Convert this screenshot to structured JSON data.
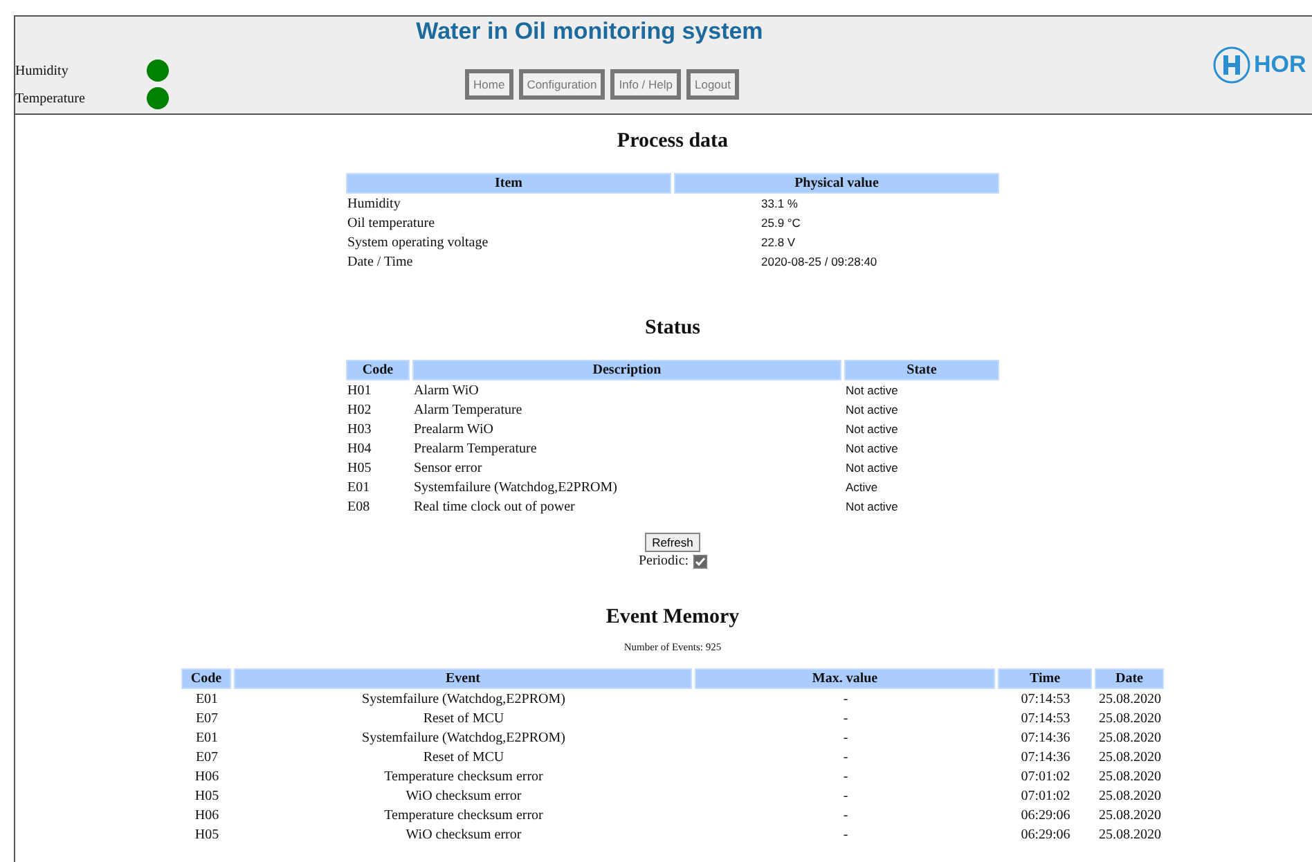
{
  "header": {
    "title": "Water in Oil monitoring system",
    "logo_text": "HOR",
    "indicators": [
      {
        "label": "Humidity",
        "color": "#008000"
      },
      {
        "label": "Temperature",
        "color": "#008000"
      }
    ],
    "nav": [
      {
        "label": "Home"
      },
      {
        "label": "Configuration"
      },
      {
        "label": "Info / Help"
      },
      {
        "label": "Logout"
      }
    ]
  },
  "process_data": {
    "title": "Process data",
    "columns": [
      "Item",
      "Physical value"
    ],
    "rows": [
      [
        "Humidity",
        "33.1 %"
      ],
      [
        "Oil temperature",
        "25.9 °C"
      ],
      [
        "System operating voltage",
        "22.8 V"
      ],
      [
        "Date / Time",
        "2020-08-25 / 09:28:40"
      ]
    ]
  },
  "status": {
    "title": "Status",
    "columns": [
      "Code",
      "Description",
      "State"
    ],
    "rows": [
      [
        "H01",
        "Alarm WiO",
        "Not active"
      ],
      [
        "H02",
        "Alarm Temperature",
        "Not active"
      ],
      [
        "H03",
        "Prealarm WiO",
        "Not active"
      ],
      [
        "H04",
        "Prealarm Temperature",
        "Not active"
      ],
      [
        "H05",
        "Sensor error",
        "Not active"
      ],
      [
        "E01",
        "Systemfailure (Watchdog,E2PROM)",
        "Active"
      ],
      [
        "E08",
        "Real time clock out of power",
        "Not active"
      ]
    ],
    "refresh_button": "Refresh",
    "periodic": {
      "label": "Periodic:",
      "checked": true
    }
  },
  "event_memory": {
    "title": "Event Memory",
    "count": "Number of Events: 925",
    "columns": [
      "Code",
      "Event",
      "Max. value",
      "Time",
      "Date"
    ],
    "rows": [
      [
        "E01",
        "Systemfailure (Watchdog,E2PROM)",
        "-",
        "07:14:53",
        "25.08.2020"
      ],
      [
        "E07",
        "Reset of MCU",
        "-",
        "07:14:53",
        "25.08.2020"
      ],
      [
        "E01",
        "Systemfailure (Watchdog,E2PROM)",
        "-",
        "07:14:36",
        "25.08.2020"
      ],
      [
        "E07",
        "Reset of MCU",
        "-",
        "07:14:36",
        "25.08.2020"
      ],
      [
        "H06",
        "Temperature checksum error",
        "-",
        "07:01:02",
        "25.08.2020"
      ],
      [
        "H05",
        "WiO checksum error",
        "-",
        "07:01:02",
        "25.08.2020"
      ],
      [
        "H06",
        "Temperature checksum error",
        "-",
        "06:29:06",
        "25.08.2020"
      ],
      [
        "H05",
        "WiO checksum error",
        "-",
        "06:29:06",
        "25.08.2020"
      ]
    ]
  }
}
